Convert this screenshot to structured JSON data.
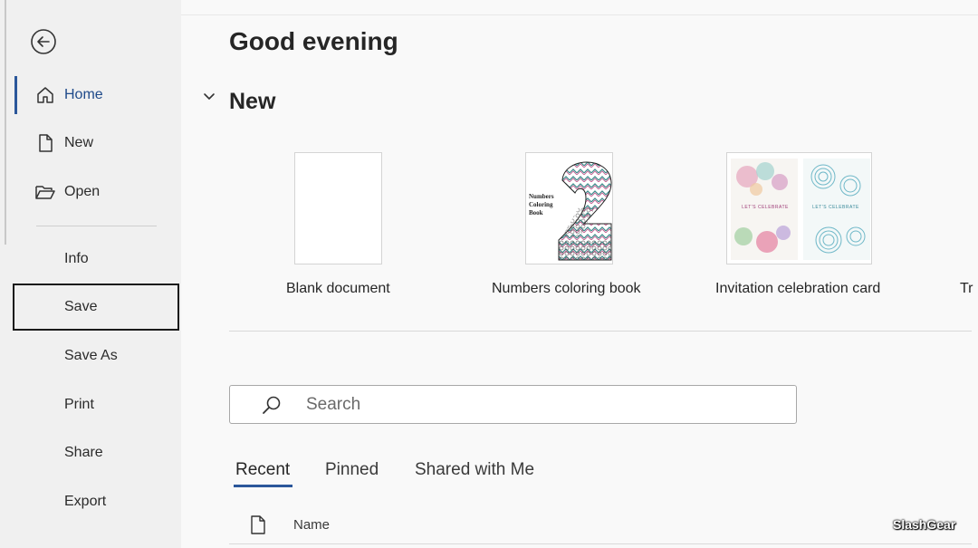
{
  "sidebar": {
    "items": [
      {
        "label": "Home",
        "icon": "home-icon"
      },
      {
        "label": "New",
        "icon": "new-document-icon"
      },
      {
        "label": "Open",
        "icon": "folder-open-icon"
      },
      {
        "label": "Info"
      },
      {
        "label": "Save"
      },
      {
        "label": "Save As"
      },
      {
        "label": "Print"
      },
      {
        "label": "Share"
      },
      {
        "label": "Export"
      }
    ],
    "active_index": 0,
    "focused_index": 4
  },
  "main": {
    "greeting": "Good evening",
    "new_section_title": "New",
    "templates": [
      {
        "label": "Blank document"
      },
      {
        "label": "Numbers coloring book",
        "thumb_text": "Numbers Coloring Book"
      },
      {
        "label": "Invitation celebration card",
        "thumb_text": "LET'S CELEBRATE"
      },
      {
        "label": "Tr"
      }
    ],
    "search": {
      "placeholder": "Search",
      "value": ""
    },
    "tabs": [
      "Recent",
      "Pinned",
      "Shared with Me"
    ],
    "active_tab": "Recent",
    "columns": [
      "Name"
    ]
  },
  "colors": {
    "accent": "#2b579a",
    "sidebar_bg": "#f0f0f0",
    "main_bg": "#f9f9f9"
  },
  "watermark": "SlashGear"
}
